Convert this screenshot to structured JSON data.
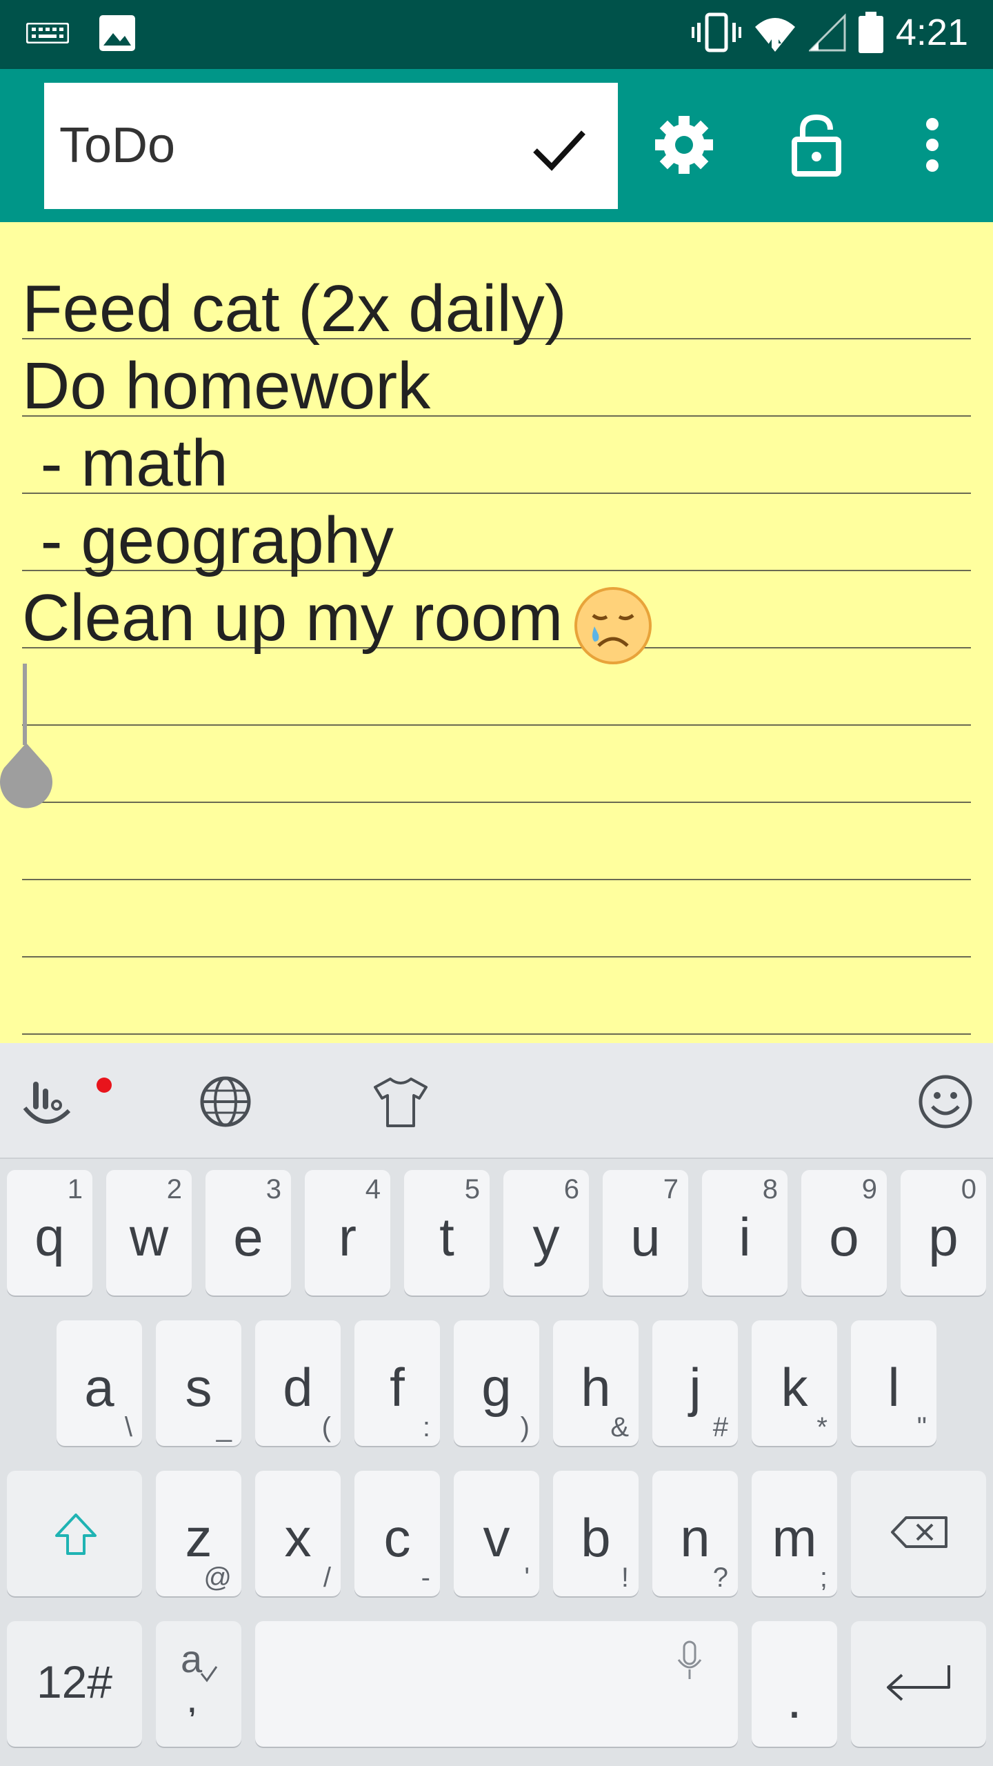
{
  "status_bar": {
    "time": "4:21",
    "left_icons": [
      "keyboard-icon",
      "image-icon"
    ],
    "right_icons": [
      "vibrate-icon",
      "wifi-icon",
      "signal-icon",
      "battery-icon"
    ]
  },
  "app_bar": {
    "title": "ToDo",
    "actions": [
      "confirm-check-icon",
      "settings-gear-icon",
      "unlock-icon",
      "more-vert-icon"
    ]
  },
  "note": {
    "lines": [
      "Feed cat (2x daily)",
      "Do homework",
      " - math",
      " - geography",
      "Clean up my room"
    ],
    "emoji": "sad-crying-face",
    "colors": {
      "paper": "#ffff9e",
      "appbar": "#009688",
      "statusbar": "#00524a"
    }
  },
  "keyboard": {
    "toolbar": [
      "voice-typing-icon",
      "language-globe-icon",
      "theme-shirt-icon",
      "emoji-smiley-icon"
    ],
    "row1": [
      {
        "key": "q",
        "hint": "1"
      },
      {
        "key": "w",
        "hint": "2"
      },
      {
        "key": "e",
        "hint": "3"
      },
      {
        "key": "r",
        "hint": "4"
      },
      {
        "key": "t",
        "hint": "5"
      },
      {
        "key": "y",
        "hint": "6"
      },
      {
        "key": "u",
        "hint": "7"
      },
      {
        "key": "i",
        "hint": "8"
      },
      {
        "key": "o",
        "hint": "9"
      },
      {
        "key": "p",
        "hint": "0"
      }
    ],
    "row2": [
      {
        "key": "a",
        "hint": "\\"
      },
      {
        "key": "s",
        "hint": "_"
      },
      {
        "key": "d",
        "hint": "("
      },
      {
        "key": "f",
        "hint": ":"
      },
      {
        "key": "g",
        "hint": ")"
      },
      {
        "key": "h",
        "hint": "&"
      },
      {
        "key": "j",
        "hint": "#"
      },
      {
        "key": "k",
        "hint": "*"
      },
      {
        "key": "l",
        "hint": "\""
      }
    ],
    "row3": [
      {
        "key": "z",
        "hint": "@"
      },
      {
        "key": "x",
        "hint": "/"
      },
      {
        "key": "c",
        "hint": "-"
      },
      {
        "key": "v",
        "hint": "'"
      },
      {
        "key": "b",
        "hint": "!"
      },
      {
        "key": "n",
        "hint": "?"
      },
      {
        "key": "m",
        "hint": ";"
      }
    ],
    "symbols_label": "12#",
    "period_label": "."
  }
}
